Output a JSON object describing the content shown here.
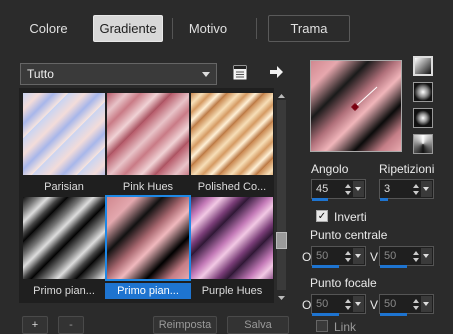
{
  "tabs": [
    {
      "label": "Colore",
      "active": false
    },
    {
      "label": "Gradiente",
      "active": true
    },
    {
      "label": "Motivo",
      "active": false
    },
    {
      "label": "Trama",
      "active": false
    }
  ],
  "category": {
    "selected": "Tutto"
  },
  "gradients": [
    {
      "caption": "Parisian",
      "selected": false
    },
    {
      "caption": "Pink Hues",
      "selected": false
    },
    {
      "caption": "Polished Co...",
      "selected": false
    },
    {
      "caption": "Primo pian...",
      "selected": false
    },
    {
      "caption": "Primo pian...",
      "selected": true
    },
    {
      "caption": "Purple Hues",
      "selected": false
    }
  ],
  "footer": {
    "add": "+",
    "remove": "-",
    "reset": "Reimposta",
    "save": "Salva"
  },
  "controls": {
    "angle_label": "Angolo",
    "angle_value": "45",
    "repeats_label": "Ripetizioni",
    "repeats_value": "3",
    "invert_label": "Inverti",
    "invert_checked": true,
    "center_label": "Punto centrale",
    "center_o": "O",
    "center_o_value": "50",
    "center_v": "V",
    "center_v_value": "50",
    "focal_label": "Punto focale",
    "focal_o": "O",
    "focal_o_value": "50",
    "focal_v": "V",
    "focal_v_value": "50",
    "link_label": "Link"
  },
  "icons": {
    "palette": "palette-icon",
    "apply": "arrow-right-icon"
  },
  "colors": {
    "accent": "#1e74d0",
    "pink": "#d08890",
    "background": "#2b2b2b"
  }
}
